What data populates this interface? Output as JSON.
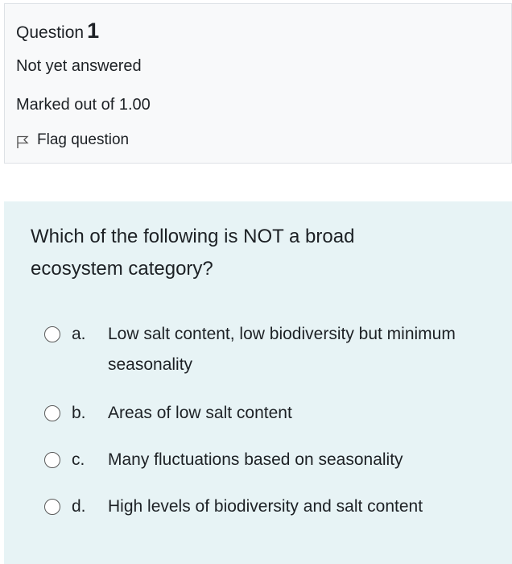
{
  "question_info": {
    "label": "Question",
    "number": "1",
    "state": "Not yet answered",
    "grade": "Marked out of 1.00",
    "flag_label": "Flag question"
  },
  "question": {
    "text": "Which of the following is NOT a broad ecosystem category?",
    "options": [
      {
        "letter": "a.",
        "text": "Low salt content, low biodiversity but minimum seasonality"
      },
      {
        "letter": "b.",
        "text": "Areas of low salt content"
      },
      {
        "letter": "c.",
        "text": "Many fluctuations based on seasonality"
      },
      {
        "letter": "d.",
        "text": "High levels of biodiversity and salt content"
      }
    ]
  },
  "icons": {
    "flag": "flag-outline-icon",
    "radio": "radio-unchecked-icon"
  },
  "colors": {
    "info_background": "#f8f9fa",
    "content_background": "#e7f3f5",
    "text": "#1d2125"
  }
}
